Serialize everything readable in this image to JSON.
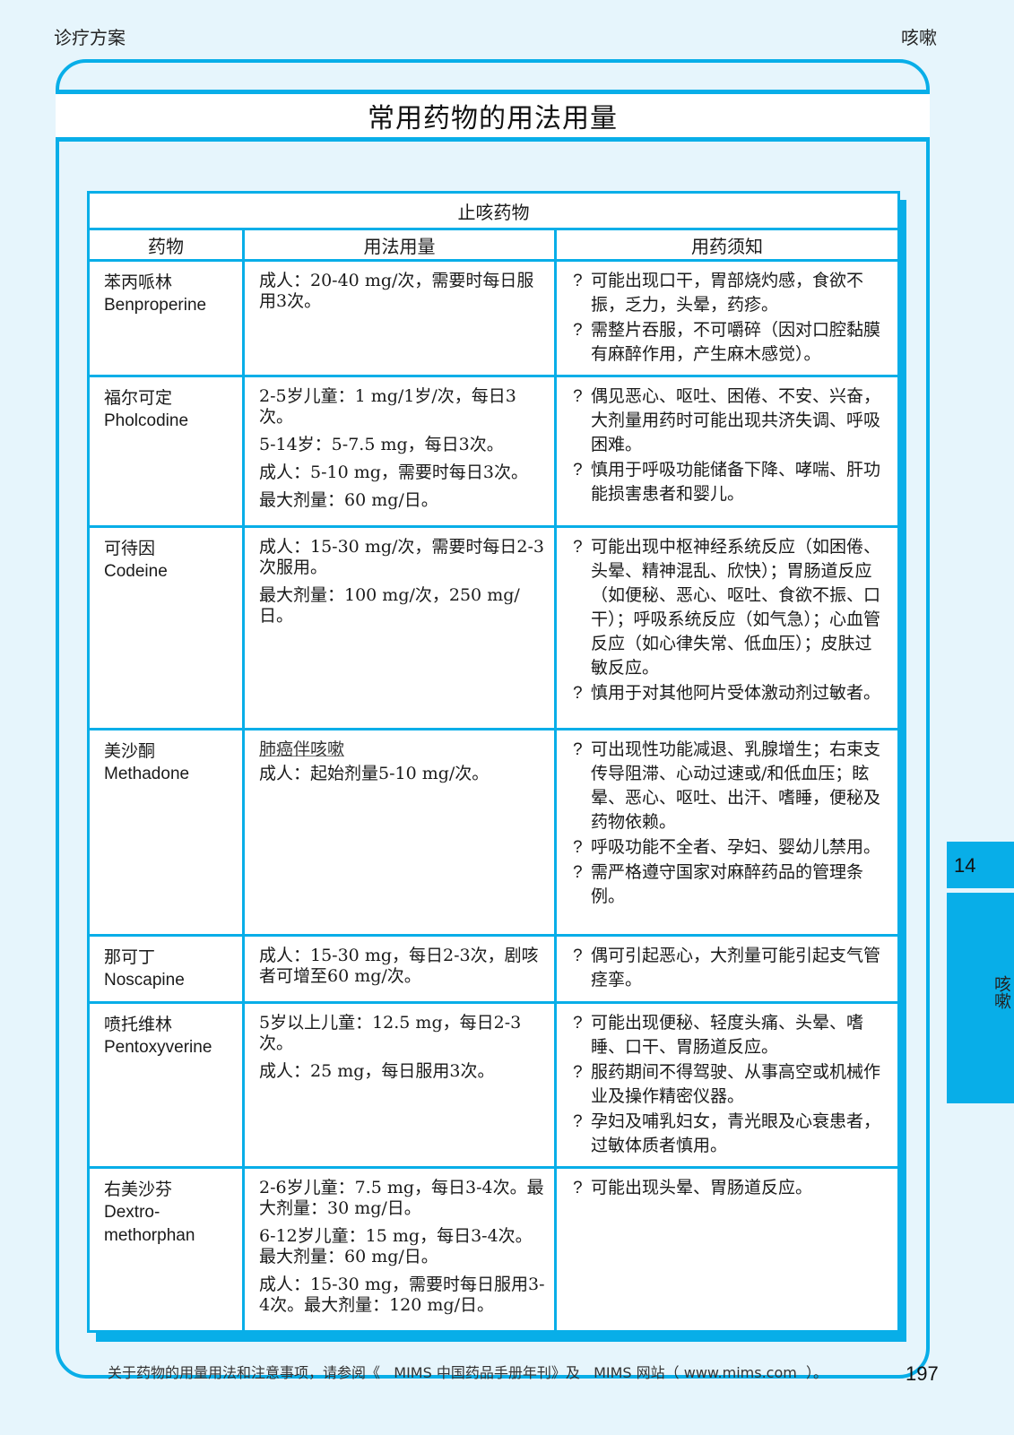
{
  "header": {
    "section": "诊疗方案",
    "chapter": "咳嗽"
  },
  "page_title": "常用药物的用法用量",
  "table": {
    "caption": "止咳药物",
    "columns": [
      "药物",
      "用法用量",
      "用药须知"
    ],
    "rows": [
      {
        "drug_cn": "苯丙哌林",
        "drug_en": "Benproperine",
        "dosage": [
          "成人：20-40 mg/次，需要时每日服用3次。"
        ],
        "notes": [
          "可能出现口干，胃部烧灼感，食欲不振，乏力，头晕，药疹。",
          "需整片吞服，不可嚼碎（因对口腔黏膜有麻醉作用，产生麻木感觉）。"
        ]
      },
      {
        "drug_cn": "福尔可定",
        "drug_en": "Pholcodine",
        "dosage": [
          "2-5岁儿童：1 mg/1岁/次，每日3次。",
          "5-14岁：5-7.5 mg，每日3次。",
          "成人：5-10 mg，需要时每日3次。",
          "最大剂量：60 mg/日。"
        ],
        "notes": [
          "偶见恶心、呕吐、困倦、不安、兴奋，大剂量用药时可能出现共济失调、呼吸困难。",
          "慎用于呼吸功能储备下降、哮喘、肝功能损害患者和婴儿。"
        ]
      },
      {
        "drug_cn": "可待因",
        "drug_en": "Codeine",
        "dosage": [
          "成人：15-30 mg/次，需要时每日2-3次服用。",
          "最大剂量：100 mg/次，250 mg/日。"
        ],
        "notes": [
          "可能出现中枢神经系统反应（如困倦、头晕、精神混乱、欣快）；胃肠道反应（如便秘、恶心、呕吐、食欲不振、口干）；呼吸系统反应（如气急）；心血管反应（如心律失常、低血压）；皮肤过敏反应。",
          "慎用于对其他阿片受体激动剂过敏者。"
        ]
      },
      {
        "drug_cn": "美沙酮",
        "drug_en": "Methadone",
        "dosage_subheading": "肺癌伴咳嗽",
        "dosage": [
          "成人：起始剂量5-10 mg/次。"
        ],
        "notes": [
          "可出现性功能减退、乳腺增生；右束支传导阻滞、心动过速或/和低血压；眩晕、恶心、呕吐、出汗、嗜睡，便秘及药物依赖。",
          "呼吸功能不全者、孕妇、婴幼儿禁用。",
          "需严格遵守国家对麻醉药品的管理条例。"
        ]
      },
      {
        "drug_cn": "那可丁",
        "drug_en": "Noscapine",
        "dosage": [
          "成人：15-30 mg，每日2-3次，剧咳者可增至60 mg/次。"
        ],
        "notes": [
          "偶可引起恶心，大剂量可能引起支气管痉挛。"
        ]
      },
      {
        "drug_cn": "喷托维林",
        "drug_en": "Pentoxyverine",
        "dosage": [
          "5岁以上儿童：12.5 mg，每日2-3次。",
          "成人：25 mg，每日服用3次。"
        ],
        "notes": [
          "可能出现便秘、轻度头痛、头晕、嗜睡、口干、胃肠道反应。",
          "服药期间不得驾驶、从事高空或机械作业及操作精密仪器。",
          "孕妇及哺乳妇女，青光眼及心衰患者，过敏体质者慎用。"
        ]
      },
      {
        "drug_cn": "右美沙芬",
        "drug_en": "Dextro-methorphan",
        "dosage": [
          "2-6岁儿童：7.5 mg，每日3-4次。最大剂量：30 mg/日。",
          "6-12岁儿童：15 mg，每日3-4次。最大剂量：60 mg/日。",
          "成人：15-30 mg，需要时每日服用3-4次。最大剂量：120 mg/日。"
        ],
        "notes": [
          "可能出现头晕、胃肠道反应。"
        ]
      }
    ]
  },
  "side_tab": {
    "number": "14",
    "label": "咳嗽"
  },
  "footer": {
    "text": "关于药物的用量用法和注意事项，请参阅《   MIMS 中国药品手册年刊》及   MIMS 网站（ www.mims.com  ）。",
    "page_number": "197"
  },
  "colors": {
    "accent": "#08aee8",
    "page_background": "#e6f5fc"
  }
}
